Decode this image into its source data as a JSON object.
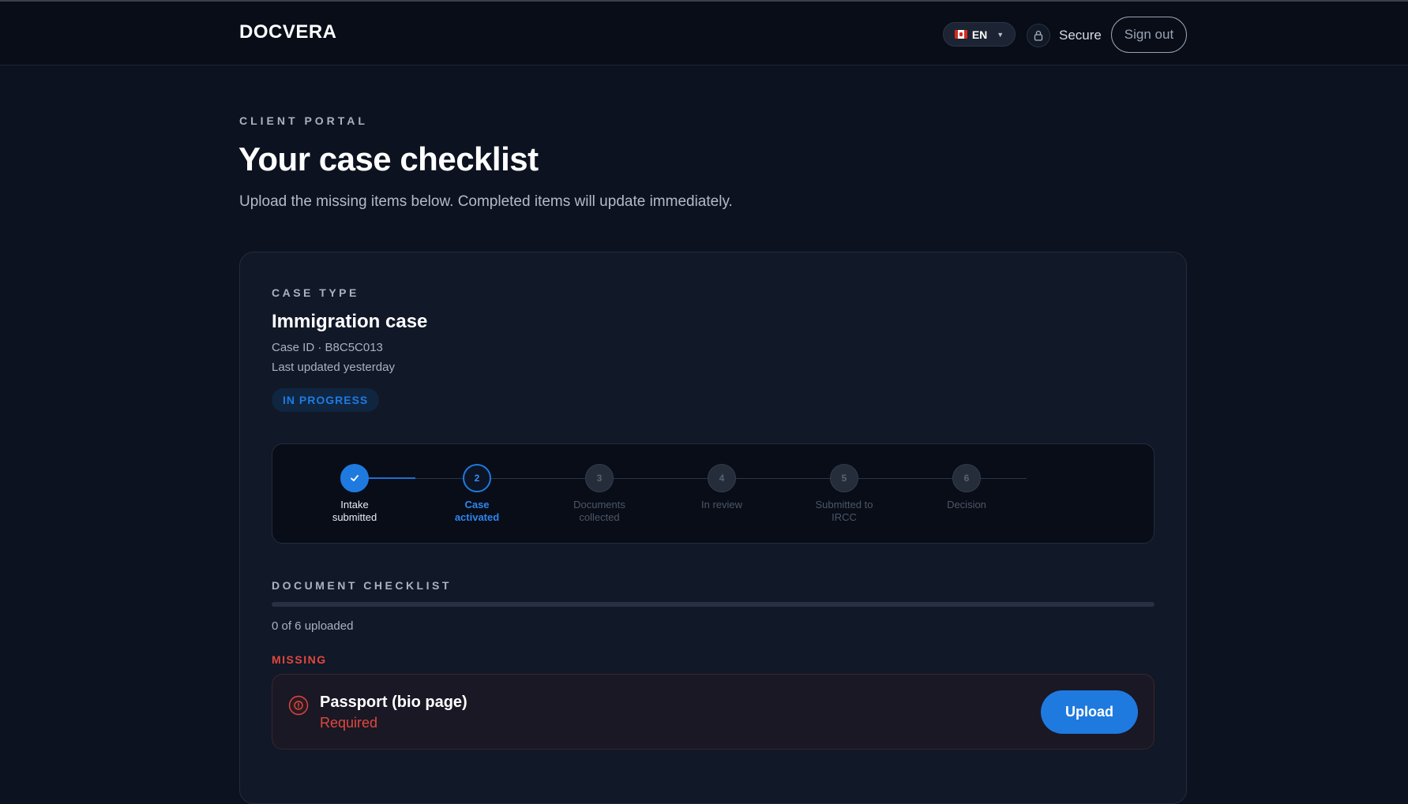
{
  "header": {
    "brand": "DOCVERA",
    "language": "EN",
    "language_flag_icon": "canada-flag-icon",
    "secure_label": "Secure",
    "sign_out_label": "Sign out"
  },
  "intro": {
    "eyebrow": "CLIENT PORTAL",
    "title": "Your case checklist",
    "subtitle": "Upload the missing items below. Completed items will update immediately."
  },
  "case": {
    "type_label": "CASE TYPE",
    "title": "Immigration case",
    "case_id": "Case ID · B8C5C013",
    "last_updated": "Last updated yesterday",
    "status_badge": "IN PROGRESS"
  },
  "steps": [
    {
      "number": "1",
      "label": "Intake\nsubmitted",
      "state": "done"
    },
    {
      "number": "2",
      "label": "Case\nactivated",
      "state": "active"
    },
    {
      "number": "3",
      "label": "Documents\ncollected",
      "state": "pending"
    },
    {
      "number": "4",
      "label": "In review",
      "state": "pending"
    },
    {
      "number": "5",
      "label": "Submitted to\nIRCC",
      "state": "pending"
    },
    {
      "number": "6",
      "label": "Decision",
      "state": "pending"
    }
  ],
  "checklist": {
    "label": "DOCUMENT CHECKLIST",
    "uploaded_count": 0,
    "total_count": 6,
    "progress_text": "0 of 6 uploaded",
    "missing_label": "MISSING",
    "items": [
      {
        "name": "Passport (bio page)",
        "status": "Required",
        "action_label": "Upload"
      }
    ]
  },
  "colors": {
    "accent": "#1f7ae0",
    "missing": "#e0483f",
    "background": "#0c1220"
  }
}
